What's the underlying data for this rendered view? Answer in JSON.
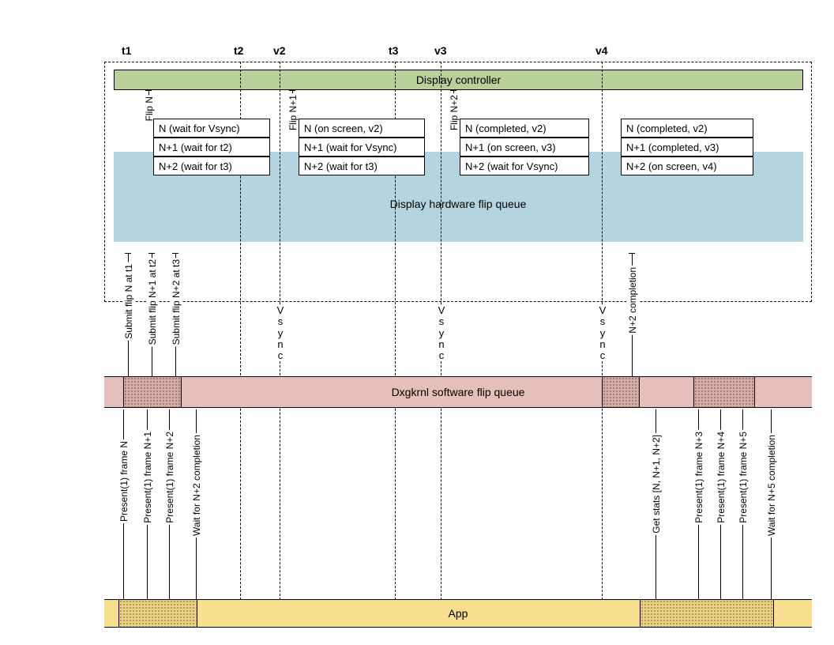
{
  "times": {
    "t1": "t1",
    "t2": "t2",
    "t3": "t3",
    "v2": "v2",
    "v3": "v3",
    "v4": "v4"
  },
  "display_controller": "Display controller",
  "hw_queue_label": "Display hardware flip queue",
  "sw_queue_label": "Dxgkrnl software flip queue",
  "app_label": "App",
  "flip_labels": {
    "n": "Flip N",
    "n1": "Flip N+1",
    "n2": "Flip N+2"
  },
  "submit_labels": {
    "n": "Submit flip N at t1",
    "n1": "Submit flip N+1 at t2",
    "n2": "Submit flip N+2 at t3"
  },
  "vsync": "Vsync",
  "n2_completion": "N+2 completion",
  "queue": {
    "c1": {
      "r1": "N (wait for Vsync)",
      "r2": "N+1 (wait for t2)",
      "r3": "N+2 (wait for t3)"
    },
    "c2": {
      "r1": "N (on screen, v2)",
      "r2": "N+1 (wait for Vsync)",
      "r3": "N+2 (wait for t3)"
    },
    "c3": {
      "r1": "N (completed, v2)",
      "r2": "N+1 (on screen, v3)",
      "r3": "N+2 (wait for Vsync)"
    },
    "c4": {
      "r1": "N (completed, v2)",
      "r2": "N+1 (completed, v3)",
      "r3": "N+2 (on screen, v4)"
    }
  },
  "present": {
    "p1": "Present(1) frame N",
    "p2": "Present(1) frame N+1",
    "p3": "Present(1) frame N+2",
    "wait1": "Wait for N+2 completion",
    "stats": "Get stats [N, N+1, N+2]",
    "p4": "Present(1) frame N+3",
    "p5": "Present(1) frame N+4",
    "p6": "Present(1) frame N+5",
    "wait2": "Wait for N+5 completion"
  }
}
